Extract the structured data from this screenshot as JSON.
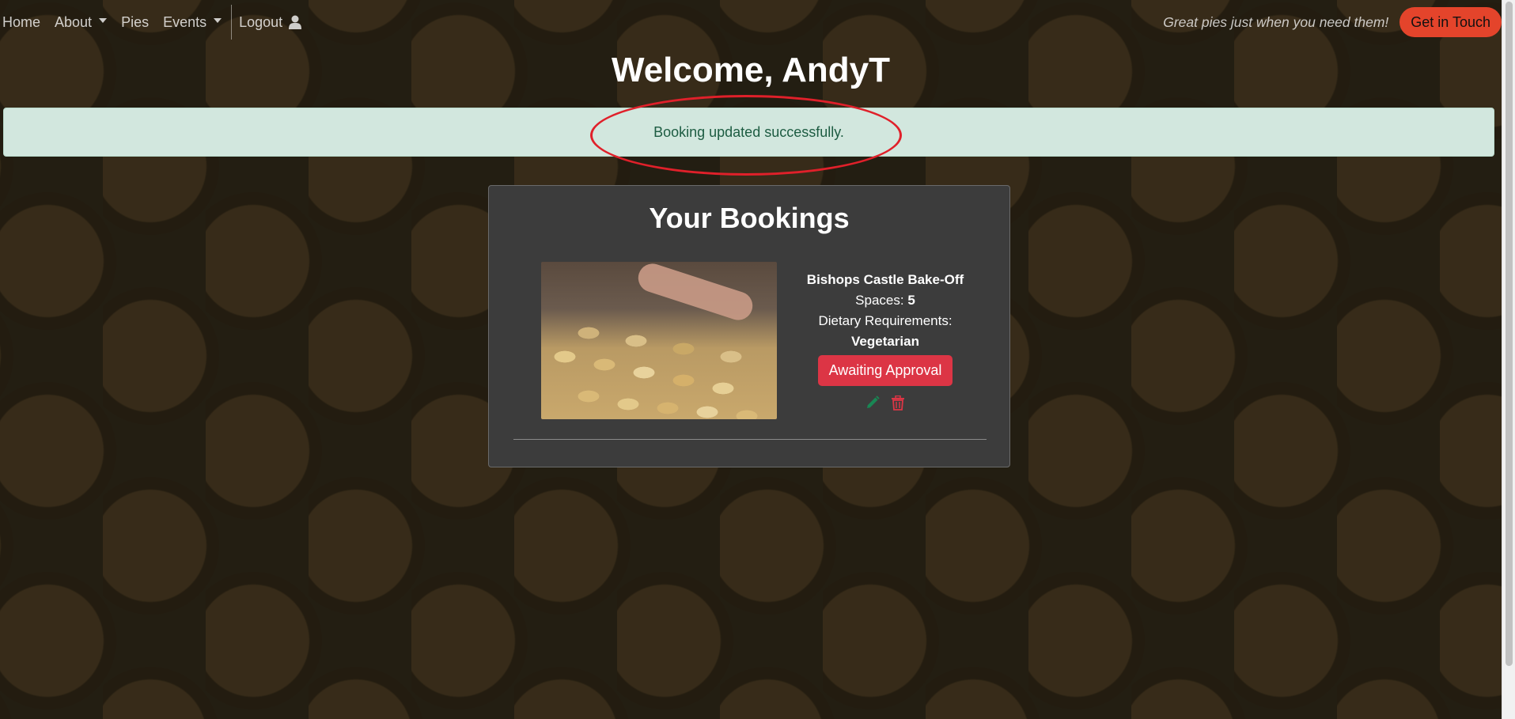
{
  "nav": {
    "items": [
      {
        "label": "Home",
        "dropdown": false
      },
      {
        "label": "About",
        "dropdown": true
      },
      {
        "label": "Pies",
        "dropdown": false
      },
      {
        "label": "Events",
        "dropdown": true
      }
    ],
    "logout_label": "Logout",
    "user_icon": "user-icon",
    "tagline": "Great pies just when you need them!",
    "cta_label": "Get in Touch"
  },
  "welcome": "Welcome, AndyT",
  "alert": {
    "message": "Booking updated successfully.",
    "annotation": "red-ellipse-highlight"
  },
  "bookings": {
    "title": "Your Bookings",
    "items": [
      {
        "event": "Bishops Castle Bake-Off",
        "spaces_label": "Spaces:",
        "spaces": "5",
        "dietary_label": "Dietary Requirements:",
        "dietary": "Vegetarian",
        "status": "Awaiting Approval",
        "edit_icon": "pencil-icon",
        "delete_icon": "trash-icon"
      }
    ]
  },
  "colors": {
    "cta": "#e4442b",
    "alert_bg": "#d2e7de",
    "alert_text": "#1d5c42",
    "status": "#dc3545",
    "edit": "#198754",
    "delete": "#dc3545",
    "card_bg": "#3c3c3c"
  }
}
